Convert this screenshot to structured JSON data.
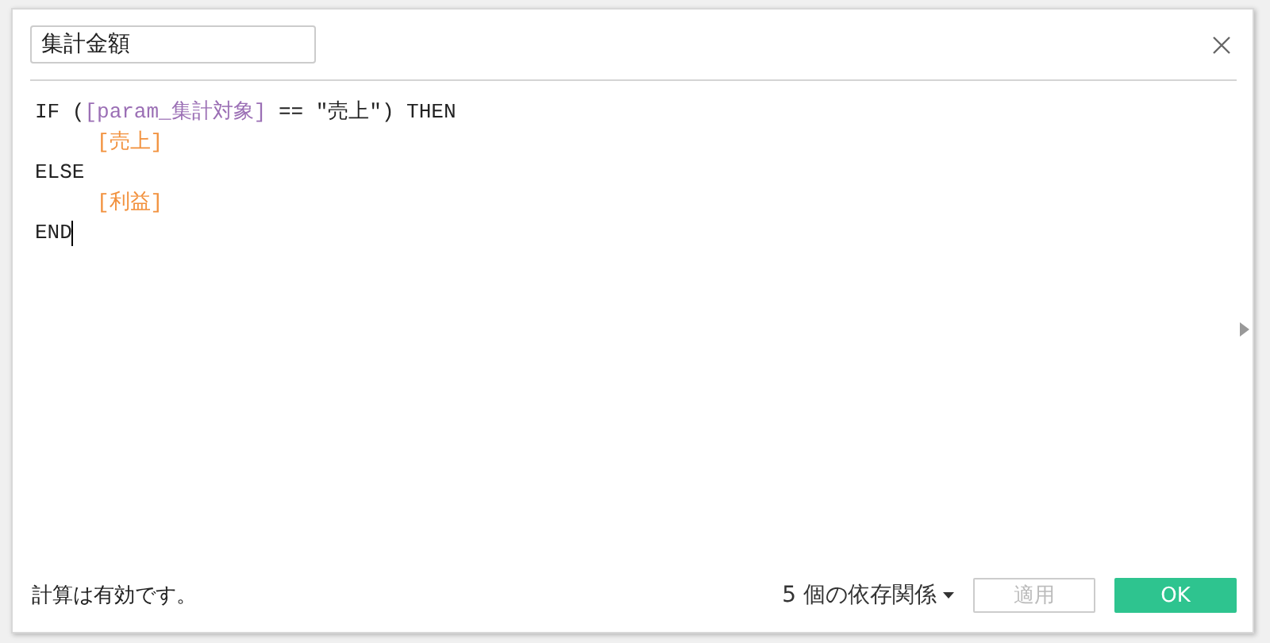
{
  "name_field": {
    "value": "集計金額"
  },
  "code_lines": [
    {
      "indent": false,
      "tokens": [
        {
          "kind": "keyword",
          "text": "IF ("
        },
        {
          "kind": "field",
          "text": "[param_集計対象]"
        },
        {
          "kind": "keyword",
          "text": " == \"売上\") THEN"
        }
      ]
    },
    {
      "indent": true,
      "tokens": [
        {
          "kind": "field_ref",
          "text": "[売上]"
        }
      ]
    },
    {
      "indent": false,
      "tokens": [
        {
          "kind": "keyword",
          "text": "ELSE"
        }
      ]
    },
    {
      "indent": true,
      "tokens": [
        {
          "kind": "field_ref",
          "text": "[利益]"
        }
      ]
    },
    {
      "indent": false,
      "cursor": true,
      "tokens": [
        {
          "kind": "keyword",
          "text": "END"
        }
      ]
    }
  ],
  "status": "計算は有効です。",
  "dependencies": "5 個の依存関係",
  "buttons": [
    {
      "label": "適用",
      "disabled": true,
      "kind": "secondary"
    },
    {
      "label": "OK",
      "disabled": false,
      "kind": "primary"
    }
  ]
}
